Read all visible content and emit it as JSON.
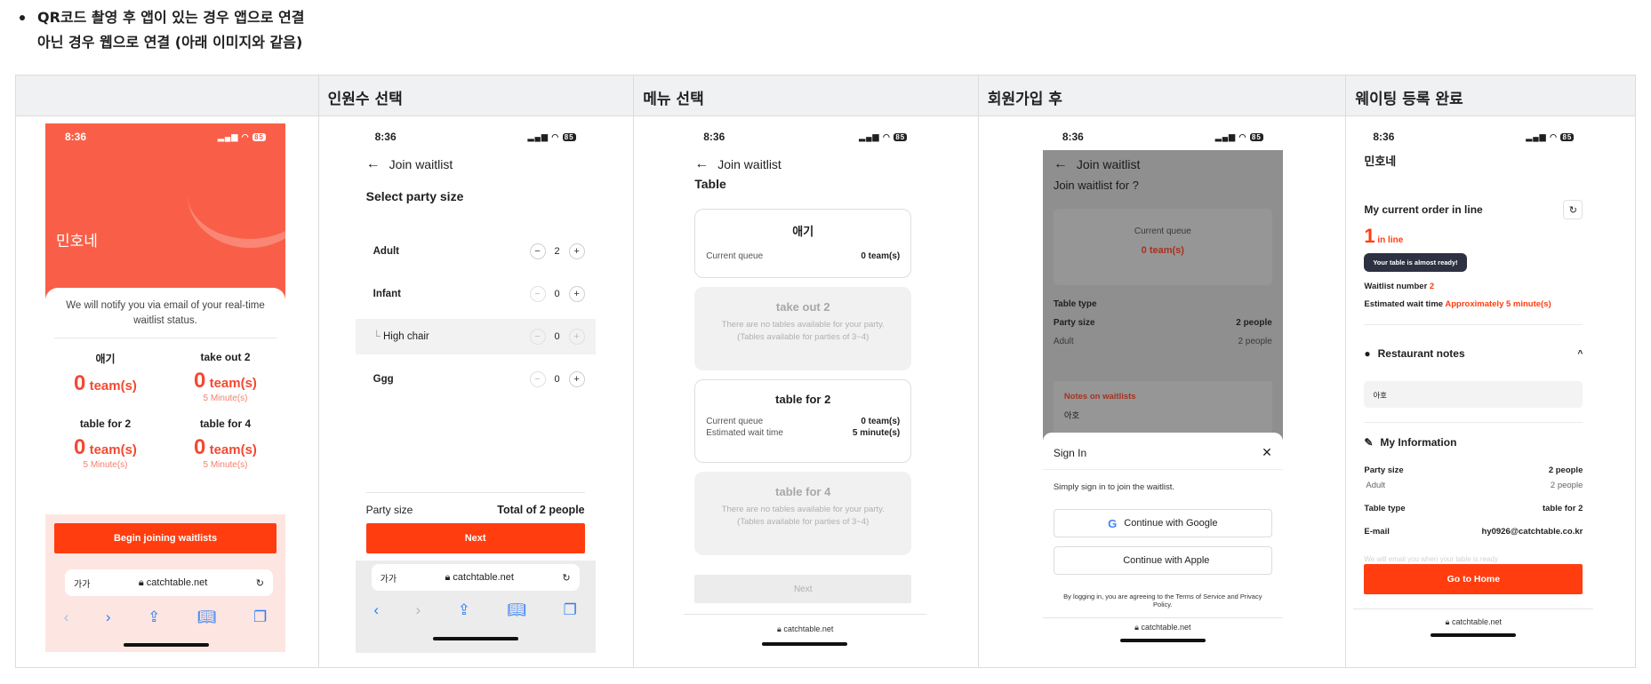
{
  "bullets": {
    "line1": "QR코드 촬영 후 앱이 있는 경우 앱으로 연결",
    "line2": "아닌 경우 웹으로 연결 (아래 이미지와 같음)"
  },
  "columns": [
    "",
    "인원수 선택",
    "메뉴 선택",
    "회원가입 후",
    "웨이팅 등록 완료"
  ],
  "status_time": "8:36",
  "battery": "85",
  "url": "catchtable.net",
  "aa": "가가",
  "screen1": {
    "restaurant": "민호네",
    "notify": "We will notify you via email of your real-time waitlist status.",
    "cells": [
      {
        "title": "애기",
        "zero": "0",
        "unit": "team(s)",
        "minutes": ""
      },
      {
        "title": "take out 2",
        "zero": "0",
        "unit": "team(s)",
        "minutes": "5 Minute(s)"
      },
      {
        "title": "table for 2",
        "zero": "0",
        "unit": "team(s)",
        "minutes": "5 Minute(s)"
      },
      {
        "title": "table for 4",
        "zero": "0",
        "unit": "team(s)",
        "minutes": "5 Minute(s)"
      }
    ],
    "cta": "Begin joining waitlists"
  },
  "screen2": {
    "back": "Join waitlist",
    "title": "Select party size",
    "rows": [
      {
        "label": "Adult",
        "value": "2"
      },
      {
        "label": "Infant",
        "value": "0"
      },
      {
        "label": "High chair",
        "value": "0"
      },
      {
        "label": "Ggg",
        "value": "0"
      }
    ],
    "party_label": "Party size",
    "party_total": "Total of 2 people",
    "next": "Next"
  },
  "screen3": {
    "back": "Join waitlist",
    "subtitle": "Table",
    "card1": {
      "title": "애기",
      "label": "Current queue",
      "value": "0 team(s)"
    },
    "card2": {
      "title": "take out 2",
      "note1": "There are no tables available for your party.",
      "note2": "(Tables available for parties of 3~4)"
    },
    "card3": {
      "title": "table for 2",
      "label1": "Current queue",
      "value1": "0 team(s)",
      "label2": "Estimated wait time",
      "value2": "5 minute(s)"
    },
    "card4": {
      "title": "table for 4",
      "note1": "There are no tables available for your party.",
      "note2": "(Tables available for parties of 3~4)"
    },
    "next": "Next"
  },
  "screen4": {
    "back": "Join waitlist",
    "heading": "Join waitlist for ?",
    "queue_label": "Current queue",
    "queue_value": "0 team(s)",
    "table_type": "Table type",
    "party_size": "Party size",
    "party_value": "2 people",
    "adult": "Adult",
    "adult_value": "2 people",
    "notes_title": "Notes on waitlists",
    "notes_text": "아호",
    "modal_title": "Sign In",
    "modal_desc": "Simply sign in to join the waitlist.",
    "google": "Continue with Google",
    "apple": "Continue with Apple",
    "legal": "By logging in, you are agreeing to the Terms of Service and Privacy Policy."
  },
  "screen5": {
    "restaurant": "민호네",
    "order_title": "My current order in line",
    "position": "1",
    "in_line": "in line",
    "tooltip": "Your table is almost ready!",
    "waitlist_label": "Waitlist number",
    "waitlist_value": "2",
    "wait_label": "Estimated wait time",
    "wait_value": "Approximately 5 minute(s)",
    "notes_title": "Restaurant notes",
    "notes_text": "아호",
    "info_title": "My Information",
    "party_label": "Party size",
    "party_value": "2 people",
    "adult_label": "Adult",
    "adult_value": "2 people",
    "table_label": "Table type",
    "table_value": "table for 2",
    "email_label": "E-mail",
    "email_value": "hy0926@catchtable.co.kr",
    "faint_note": "We will email you when your table is ready",
    "home": "Go to Home"
  },
  "colors": {
    "brand": "#ff3d0f",
    "coral": "#f95f48",
    "link": "#2f7cf6"
  }
}
